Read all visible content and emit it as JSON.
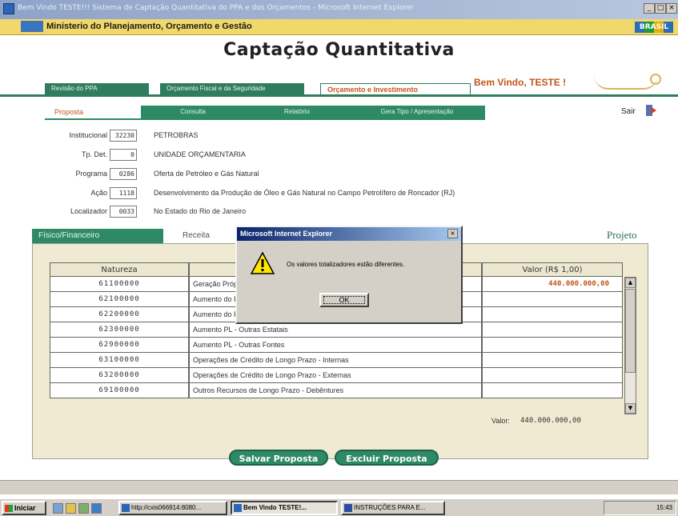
{
  "window": {
    "title": "Bem Vindo TESTE!!! Sistema de Captação Quantitativa do PPA e dos Orçamentos - Microsoft Internet Explorer",
    "buttons": [
      "_",
      "□",
      "×"
    ]
  },
  "ministry": {
    "name": "Ministerio do Planejamento, Orçamento e Gestão",
    "brand": "BRASIL"
  },
  "app": {
    "title": "Captação Quantitativa",
    "welcome": "Bem Vindo, TESTE !"
  },
  "top_tabs": [
    {
      "label": "Revisão do PPA"
    },
    {
      "label": "Orçamento Fiscal e da Seguridade"
    },
    {
      "label": "Orçamento e Investimento"
    }
  ],
  "sub_tabs": [
    {
      "label": "Proposta"
    },
    {
      "label": "Consulta"
    },
    {
      "label": "Relatório"
    },
    {
      "label": "Gera Tipo / Apresentação"
    }
  ],
  "exit_label": "Sair",
  "form": [
    {
      "label": "Institucional",
      "code": "32230",
      "desc": "PETROBRAS"
    },
    {
      "label": "Tp. Det.",
      "code": "0",
      "desc": "UNIDADE ORÇAMENTARIA"
    },
    {
      "label": "Programa",
      "code": "0286",
      "desc": "Oferta de Petróleo e Gás Natural"
    },
    {
      "label": "Ação",
      "code": "1118",
      "desc": "Desenvolvimento da Produção de Óleo e Gás Natural no Campo Petrolífero de Roncador (RJ)"
    },
    {
      "label": "Localizador",
      "code": "0033",
      "desc": "No Estado do Rio de Janeiro"
    }
  ],
  "panel_tabs": {
    "fisico": "Físico/Financeiro",
    "receita": "Receita"
  },
  "projeto_label": "Projeto",
  "table": {
    "headers": {
      "natureza": "Natureza",
      "valor": "Valor (R$ 1,00)"
    },
    "rows": [
      {
        "natureza": "61100000",
        "desc": "Geração Própria",
        "valor": "440.000.000,00"
      },
      {
        "natureza": "62100000",
        "desc": "Aumento do PL - Controladora",
        "valor": ""
      },
      {
        "natureza": "62200000",
        "desc": "Aumento do PL - Controladora",
        "valor": ""
      },
      {
        "natureza": "62300000",
        "desc": "Aumento PL - Outras Estatais",
        "valor": ""
      },
      {
        "natureza": "62900000",
        "desc": "Aumento PL - Outras Fontes",
        "valor": ""
      },
      {
        "natureza": "63100000",
        "desc": "Operações de Crédito de Longo Prazo - Internas",
        "valor": ""
      },
      {
        "natureza": "63200000",
        "desc": "Operações de Crédito de Longo Prazo - Externas",
        "valor": ""
      },
      {
        "natureza": "69100000",
        "desc": "Outros Recursos de Longo Prazo - Debêntures",
        "valor": ""
      }
    ]
  },
  "total": {
    "label": "Valor:",
    "value": "440.000.000,00"
  },
  "actions": {
    "save": "Salvar Proposta",
    "delete": "Excluir Proposta"
  },
  "dialog": {
    "title": "Microsoft Internet Explorer",
    "message": "Os valores totalizadores estão diferentes.",
    "ok": "OK",
    "close": "×"
  },
  "taskbar": {
    "start": "Iniciar",
    "buttons": [
      "http://cxis066914:8080...",
      "Bem Vindo TESTE!...",
      "INSTRUÇÕES PARA E..."
    ],
    "clock": "15:43"
  }
}
